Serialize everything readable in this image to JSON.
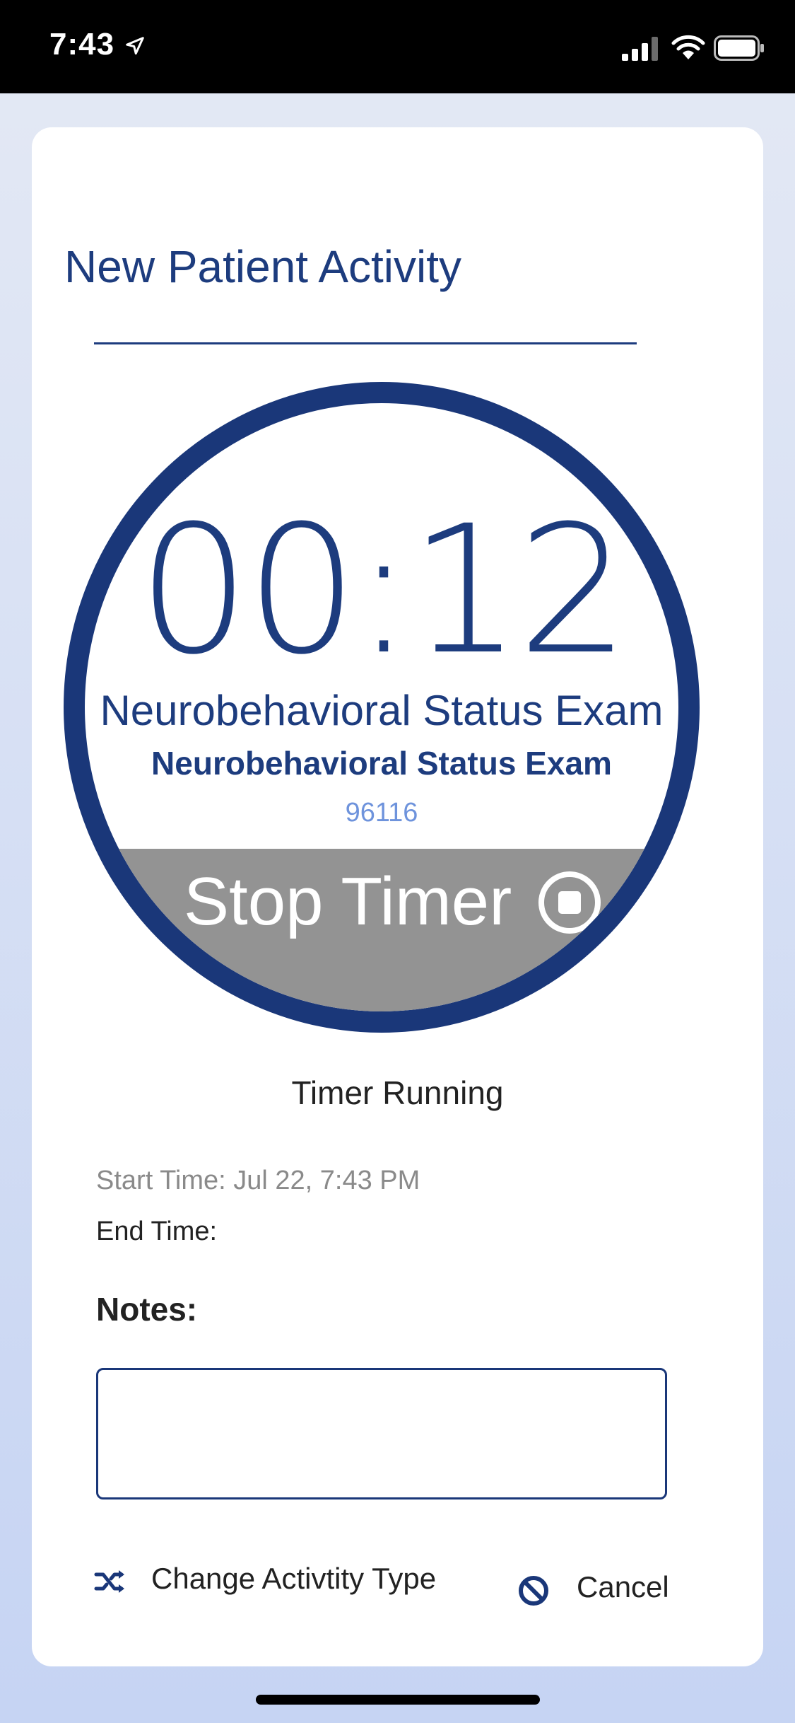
{
  "status_bar": {
    "time": "7:43",
    "icons": [
      "location-arrow-icon",
      "signal-icon",
      "wifi-icon",
      "battery-icon"
    ]
  },
  "card": {
    "title": "New Patient Activity"
  },
  "timer": {
    "elapsed": "00:12",
    "activity_name": "Neurobehavioral Status Exam",
    "activity_subname": "Neurobehavioral Status Exam",
    "activity_code": "96116",
    "stop_label": "Stop Timer",
    "status": "Timer Running"
  },
  "details": {
    "start_time": "Start Time:  Jul 22, 7:43 PM",
    "end_time": "End Time:",
    "notes_label": "Notes:",
    "notes_value": ""
  },
  "actions": {
    "change_type_label": "Change Activtity Type",
    "cancel_label": "Cancel"
  },
  "colors": {
    "brand_navy": "#1a3779",
    "code_blue": "#6e93dc",
    "stop_gray": "#939393"
  }
}
